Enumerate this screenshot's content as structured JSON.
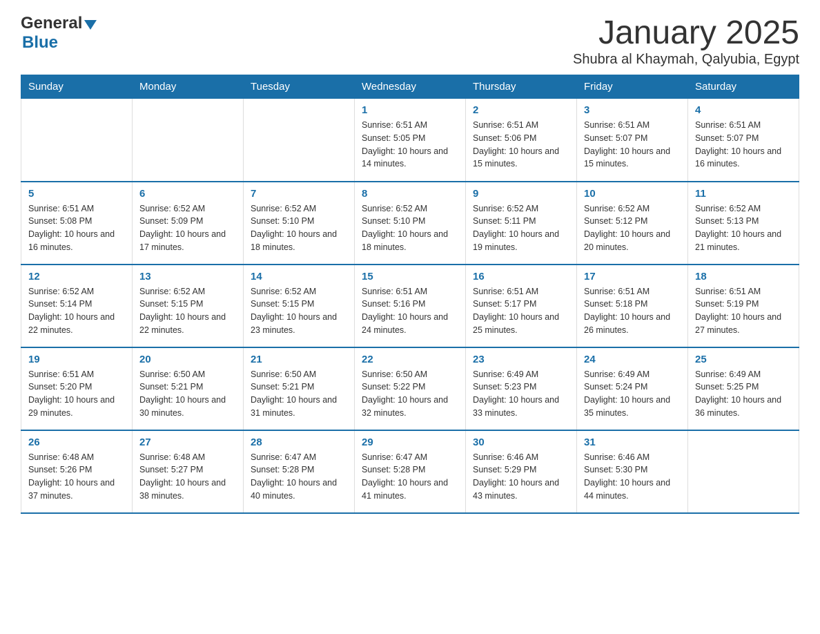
{
  "logo": {
    "text1": "General",
    "text2": "Blue"
  },
  "title": "January 2025",
  "location": "Shubra al Khaymah, Qalyubia, Egypt",
  "weekdays": [
    "Sunday",
    "Monday",
    "Tuesday",
    "Wednesday",
    "Thursday",
    "Friday",
    "Saturday"
  ],
  "weeks": [
    [
      {
        "day": "",
        "sunrise": "",
        "sunset": "",
        "daylight": ""
      },
      {
        "day": "",
        "sunrise": "",
        "sunset": "",
        "daylight": ""
      },
      {
        "day": "",
        "sunrise": "",
        "sunset": "",
        "daylight": ""
      },
      {
        "day": "1",
        "sunrise": "Sunrise: 6:51 AM",
        "sunset": "Sunset: 5:05 PM",
        "daylight": "Daylight: 10 hours and 14 minutes."
      },
      {
        "day": "2",
        "sunrise": "Sunrise: 6:51 AM",
        "sunset": "Sunset: 5:06 PM",
        "daylight": "Daylight: 10 hours and 15 minutes."
      },
      {
        "day": "3",
        "sunrise": "Sunrise: 6:51 AM",
        "sunset": "Sunset: 5:07 PM",
        "daylight": "Daylight: 10 hours and 15 minutes."
      },
      {
        "day": "4",
        "sunrise": "Sunrise: 6:51 AM",
        "sunset": "Sunset: 5:07 PM",
        "daylight": "Daylight: 10 hours and 16 minutes."
      }
    ],
    [
      {
        "day": "5",
        "sunrise": "Sunrise: 6:51 AM",
        "sunset": "Sunset: 5:08 PM",
        "daylight": "Daylight: 10 hours and 16 minutes."
      },
      {
        "day": "6",
        "sunrise": "Sunrise: 6:52 AM",
        "sunset": "Sunset: 5:09 PM",
        "daylight": "Daylight: 10 hours and 17 minutes."
      },
      {
        "day": "7",
        "sunrise": "Sunrise: 6:52 AM",
        "sunset": "Sunset: 5:10 PM",
        "daylight": "Daylight: 10 hours and 18 minutes."
      },
      {
        "day": "8",
        "sunrise": "Sunrise: 6:52 AM",
        "sunset": "Sunset: 5:10 PM",
        "daylight": "Daylight: 10 hours and 18 minutes."
      },
      {
        "day": "9",
        "sunrise": "Sunrise: 6:52 AM",
        "sunset": "Sunset: 5:11 PM",
        "daylight": "Daylight: 10 hours and 19 minutes."
      },
      {
        "day": "10",
        "sunrise": "Sunrise: 6:52 AM",
        "sunset": "Sunset: 5:12 PM",
        "daylight": "Daylight: 10 hours and 20 minutes."
      },
      {
        "day": "11",
        "sunrise": "Sunrise: 6:52 AM",
        "sunset": "Sunset: 5:13 PM",
        "daylight": "Daylight: 10 hours and 21 minutes."
      }
    ],
    [
      {
        "day": "12",
        "sunrise": "Sunrise: 6:52 AM",
        "sunset": "Sunset: 5:14 PM",
        "daylight": "Daylight: 10 hours and 22 minutes."
      },
      {
        "day": "13",
        "sunrise": "Sunrise: 6:52 AM",
        "sunset": "Sunset: 5:15 PM",
        "daylight": "Daylight: 10 hours and 22 minutes."
      },
      {
        "day": "14",
        "sunrise": "Sunrise: 6:52 AM",
        "sunset": "Sunset: 5:15 PM",
        "daylight": "Daylight: 10 hours and 23 minutes."
      },
      {
        "day": "15",
        "sunrise": "Sunrise: 6:51 AM",
        "sunset": "Sunset: 5:16 PM",
        "daylight": "Daylight: 10 hours and 24 minutes."
      },
      {
        "day": "16",
        "sunrise": "Sunrise: 6:51 AM",
        "sunset": "Sunset: 5:17 PM",
        "daylight": "Daylight: 10 hours and 25 minutes."
      },
      {
        "day": "17",
        "sunrise": "Sunrise: 6:51 AM",
        "sunset": "Sunset: 5:18 PM",
        "daylight": "Daylight: 10 hours and 26 minutes."
      },
      {
        "day": "18",
        "sunrise": "Sunrise: 6:51 AM",
        "sunset": "Sunset: 5:19 PM",
        "daylight": "Daylight: 10 hours and 27 minutes."
      }
    ],
    [
      {
        "day": "19",
        "sunrise": "Sunrise: 6:51 AM",
        "sunset": "Sunset: 5:20 PM",
        "daylight": "Daylight: 10 hours and 29 minutes."
      },
      {
        "day": "20",
        "sunrise": "Sunrise: 6:50 AM",
        "sunset": "Sunset: 5:21 PM",
        "daylight": "Daylight: 10 hours and 30 minutes."
      },
      {
        "day": "21",
        "sunrise": "Sunrise: 6:50 AM",
        "sunset": "Sunset: 5:21 PM",
        "daylight": "Daylight: 10 hours and 31 minutes."
      },
      {
        "day": "22",
        "sunrise": "Sunrise: 6:50 AM",
        "sunset": "Sunset: 5:22 PM",
        "daylight": "Daylight: 10 hours and 32 minutes."
      },
      {
        "day": "23",
        "sunrise": "Sunrise: 6:49 AM",
        "sunset": "Sunset: 5:23 PM",
        "daylight": "Daylight: 10 hours and 33 minutes."
      },
      {
        "day": "24",
        "sunrise": "Sunrise: 6:49 AM",
        "sunset": "Sunset: 5:24 PM",
        "daylight": "Daylight: 10 hours and 35 minutes."
      },
      {
        "day": "25",
        "sunrise": "Sunrise: 6:49 AM",
        "sunset": "Sunset: 5:25 PM",
        "daylight": "Daylight: 10 hours and 36 minutes."
      }
    ],
    [
      {
        "day": "26",
        "sunrise": "Sunrise: 6:48 AM",
        "sunset": "Sunset: 5:26 PM",
        "daylight": "Daylight: 10 hours and 37 minutes."
      },
      {
        "day": "27",
        "sunrise": "Sunrise: 6:48 AM",
        "sunset": "Sunset: 5:27 PM",
        "daylight": "Daylight: 10 hours and 38 minutes."
      },
      {
        "day": "28",
        "sunrise": "Sunrise: 6:47 AM",
        "sunset": "Sunset: 5:28 PM",
        "daylight": "Daylight: 10 hours and 40 minutes."
      },
      {
        "day": "29",
        "sunrise": "Sunrise: 6:47 AM",
        "sunset": "Sunset: 5:28 PM",
        "daylight": "Daylight: 10 hours and 41 minutes."
      },
      {
        "day": "30",
        "sunrise": "Sunrise: 6:46 AM",
        "sunset": "Sunset: 5:29 PM",
        "daylight": "Daylight: 10 hours and 43 minutes."
      },
      {
        "day": "31",
        "sunrise": "Sunrise: 6:46 AM",
        "sunset": "Sunset: 5:30 PM",
        "daylight": "Daylight: 10 hours and 44 minutes."
      },
      {
        "day": "",
        "sunrise": "",
        "sunset": "",
        "daylight": ""
      }
    ]
  ]
}
